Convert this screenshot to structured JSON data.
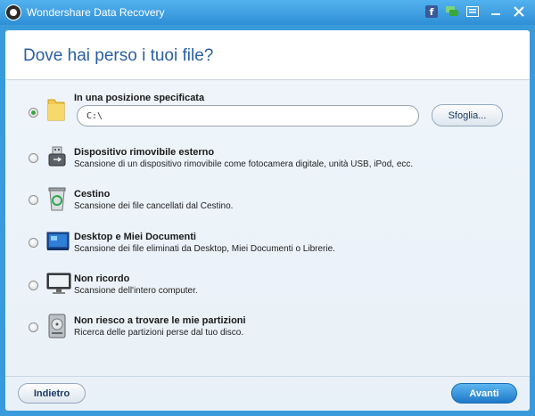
{
  "window": {
    "title": "Wondershare Data Recovery"
  },
  "heading": "Dove hai perso i tuoi file?",
  "location": {
    "title": "In una posizione specificata",
    "path_value": "C:\\",
    "browse_label": "Sfoglia..."
  },
  "options": [
    {
      "title": "Dispositivo rimovibile esterno",
      "desc": "Scansione di un dispositivo rimovibile come fotocamera digitale, unità USB, iPod, ecc."
    },
    {
      "title": "Cestino",
      "desc": "Scansione dei file cancellati dal Cestino."
    },
    {
      "title": "Desktop e Miei Documenti",
      "desc": "Scansione dei file eliminati da Desktop, Miei Documenti o Librerie."
    },
    {
      "title": "Non ricordo",
      "desc": "Scansione dell'intero computer."
    },
    {
      "title": "Non riesco a trovare le mie partizioni",
      "desc": "Ricerca delle partizioni perse dal tuo disco."
    }
  ],
  "footer": {
    "back_label": "Indietro",
    "next_label": "Avanti"
  },
  "colors": {
    "titlebar": "#3a9bdc",
    "heading": "#2a5fa3",
    "primary_button": "#1f79c8",
    "selected_radio": "#3aa83a"
  },
  "icons": [
    "facebook-icon",
    "chat-icon",
    "menu-icon",
    "minimize-icon",
    "close-icon",
    "folder-icon",
    "usb-icon",
    "recycle-bin-icon",
    "desktop-icon",
    "monitor-icon",
    "hard-disk-icon"
  ]
}
